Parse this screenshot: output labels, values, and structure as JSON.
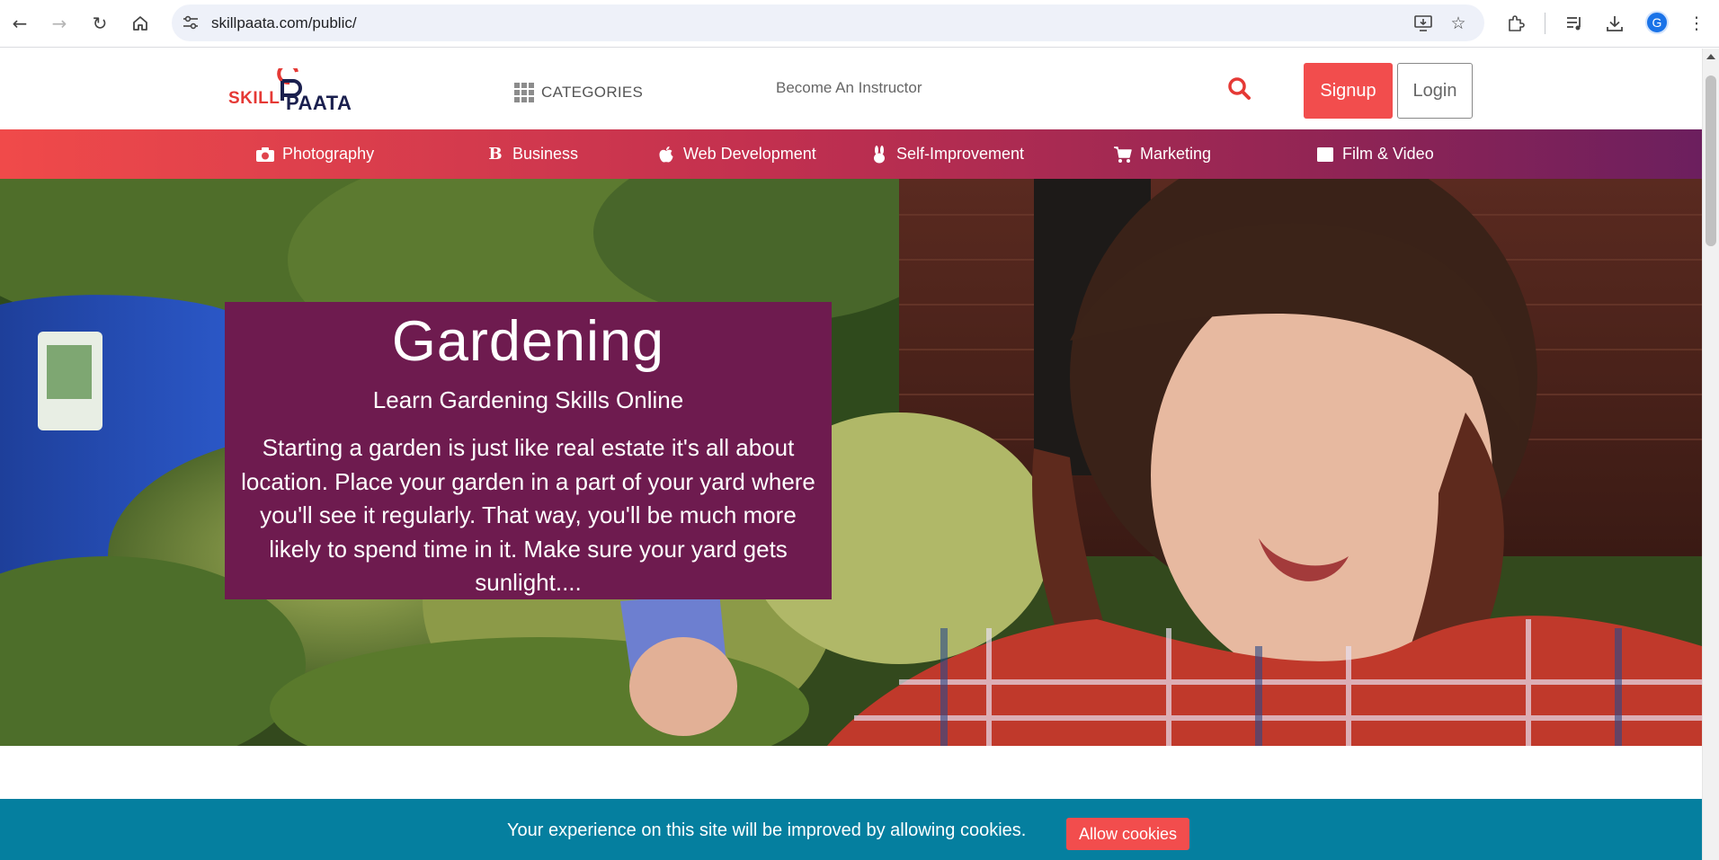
{
  "browser": {
    "url": "skillpaata.com/public/",
    "avatar_letter": "G",
    "icons": [
      "back-icon",
      "forward-icon",
      "reload-icon",
      "home-icon",
      "site-settings-icon",
      "install-app-icon",
      "star-icon",
      "extensions-icon",
      "media-icon",
      "download-icon",
      "menu-icon"
    ]
  },
  "header": {
    "logo_skill": "SKILL",
    "logo_paata": "PAATA",
    "categories_label": "CATEGORIES",
    "instructor_label": "Become An Instructor",
    "signup_label": "Signup",
    "login_label": "Login"
  },
  "category_nav": {
    "items": [
      {
        "label": "Photography",
        "icon": "camera-icon"
      },
      {
        "label": "Business",
        "icon": "bold-b-icon"
      },
      {
        "label": "Web Development",
        "icon": "apple-icon"
      },
      {
        "label": "Self-Improvement",
        "icon": "bunny-icon"
      },
      {
        "label": "Marketing",
        "icon": "cart-icon"
      },
      {
        "label": "Film & Video",
        "icon": "film-icon"
      }
    ]
  },
  "hero": {
    "title": "Gardening",
    "subtitle": "Learn Gardening Skills Online",
    "description": "Starting a garden is just like real estate it's all about location. Place your garden in a part of your yard where you'll see it regularly. That way, you'll be much more likely to spend time in it. Make sure your yard gets sunlight...."
  },
  "cookie": {
    "message": "Your experience on this site will be improved by allowing cookies.",
    "button_label": "Allow cookies"
  },
  "colors": {
    "accent_red": "#f24d4d",
    "hero_card": "#6e1b4f",
    "cookie_bar": "#057f9f",
    "nav_gradient_start": "#f04a4a",
    "nav_gradient_end": "#6c1f5e"
  }
}
